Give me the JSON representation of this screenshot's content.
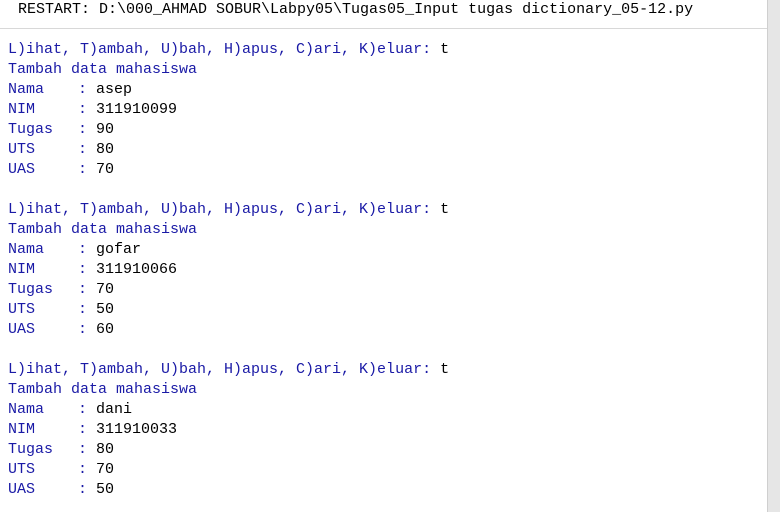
{
  "restart_line": "RESTART: D:\\000_AHMAD SOBUR\\Labpy05\\Tugas05_Input tugas dictionary_05-12.py",
  "colon": ": ",
  "sessions": [
    {
      "menu": "L)ihat, T)ambah, U)bah, H)apus, C)ari, K)eluar: ",
      "choice": "t",
      "header": "Tambah data mahasiswa",
      "fields": [
        {
          "label": "Nama",
          "value": "asep"
        },
        {
          "label": "NIM",
          "value": "311910099"
        },
        {
          "label": "Tugas",
          "value": "90"
        },
        {
          "label": "UTS",
          "value": "80"
        },
        {
          "label": "UAS",
          "value": "70"
        }
      ]
    },
    {
      "menu": "L)ihat, T)ambah, U)bah, H)apus, C)ari, K)eluar: ",
      "choice": "t",
      "header": "Tambah data mahasiswa",
      "fields": [
        {
          "label": "Nama",
          "value": "gofar"
        },
        {
          "label": "NIM",
          "value": "311910066"
        },
        {
          "label": "Tugas",
          "value": "70"
        },
        {
          "label": "UTS",
          "value": "50"
        },
        {
          "label": "UAS",
          "value": "60"
        }
      ]
    },
    {
      "menu": "L)ihat, T)ambah, U)bah, H)apus, C)ari, K)eluar: ",
      "choice": "t",
      "header": "Tambah data mahasiswa",
      "fields": [
        {
          "label": "Nama",
          "value": "dani"
        },
        {
          "label": "NIM",
          "value": "311910033"
        },
        {
          "label": "Tugas",
          "value": "80"
        },
        {
          "label": "UTS",
          "value": "70"
        },
        {
          "label": "UAS",
          "value": "50"
        }
      ]
    }
  ],
  "colors": {
    "prompt": "#1a1aa6",
    "output": "#000000",
    "background": "#ffffff"
  }
}
